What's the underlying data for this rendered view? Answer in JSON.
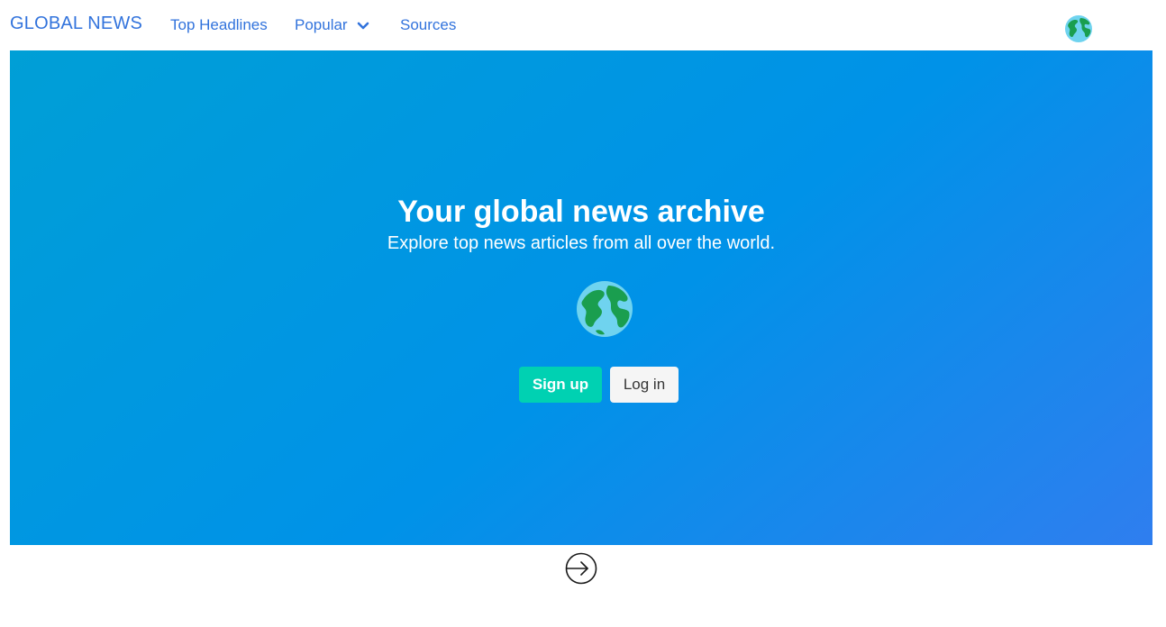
{
  "navbar": {
    "brand": "GLOBAL NEWS",
    "links": {
      "top_headlines": "Top Headlines",
      "popular": "Popular",
      "sources": "Sources"
    },
    "right_icon": "globe-icon"
  },
  "hero": {
    "title": "Your global news archive",
    "subtitle": "Explore top news articles from all over the world.",
    "icon": "globe-icon",
    "buttons": {
      "signup": "Sign up",
      "login": "Log in"
    }
  },
  "footer": {
    "icon": "enter-arrow-icon"
  },
  "colors": {
    "link": "#3273dc",
    "hero_start": "#009fd6",
    "hero_end": "#2f7eef",
    "primary_button": "#00d1b2",
    "light_button": "#f5f5f5"
  }
}
